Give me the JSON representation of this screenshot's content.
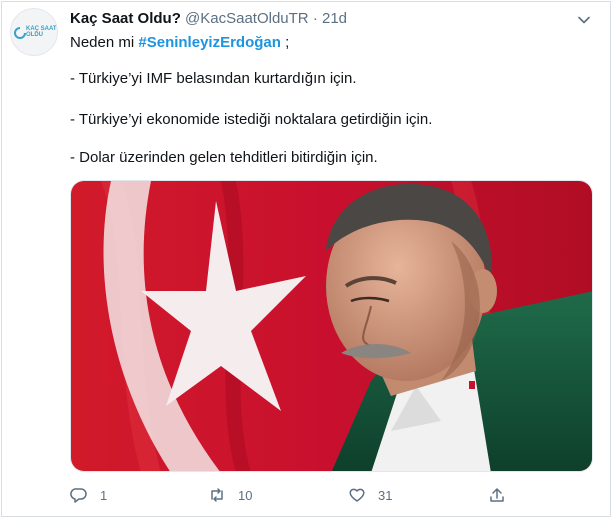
{
  "tweet": {
    "author_name": "Kaç Saat Oldu?",
    "author_handle": "@KacSaatOlduTR",
    "separator": "·",
    "time": "21d",
    "avatar_logo_line1": "KAÇ SAAT",
    "avatar_logo_line2": "OLDU",
    "intro_prefix": "Neden mi ",
    "hashtag": "#SeninleyizErdoğan",
    "intro_suffix": " ;",
    "lines": [
      "- Türkiye’yi IMF belasından kurtardığın için.",
      "- Türkiye’yi ekonomide istediği noktalara getirdiğin için.",
      "- Dolar üzerinden gelen tehditleri bitirdiğin için."
    ]
  },
  "actions": {
    "reply_count": "1",
    "retweet_count": "10",
    "like_count": "31"
  },
  "icons": [
    "caret-down-icon",
    "reply-icon",
    "retweet-icon",
    "like-icon",
    "share-icon"
  ],
  "colors": {
    "hashtag": "#1b95e0",
    "muted": "#5b7083",
    "flag_red": "#c8102e"
  }
}
